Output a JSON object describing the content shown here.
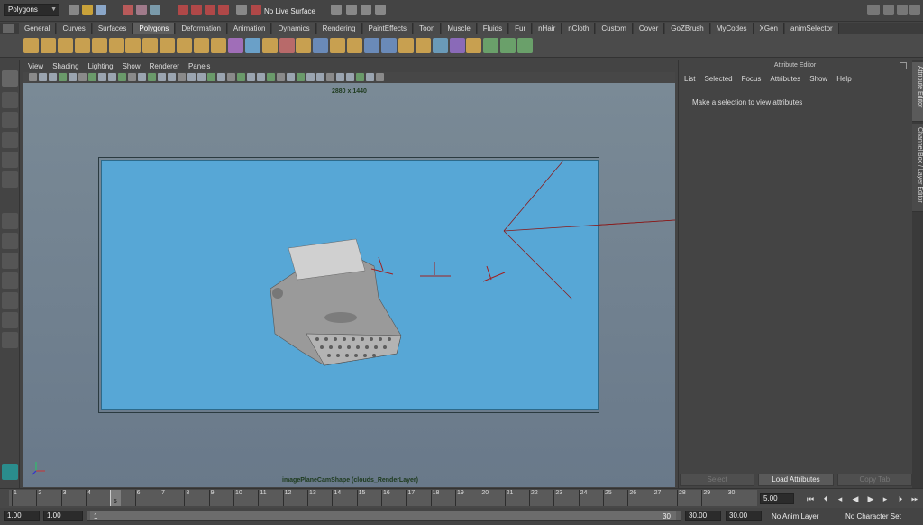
{
  "status_line": {
    "mode_menu": "Polygons",
    "live_surface": "No Live Surface"
  },
  "shelf_tabs": [
    "General",
    "Curves",
    "Surfaces",
    "Polygons",
    "Deformation",
    "Animation",
    "Dynamics",
    "Rendering",
    "PaintEffects",
    "Toon",
    "Muscle",
    "Fluids",
    "Fur",
    "nHair",
    "nCloth",
    "Custom",
    "Cover",
    "GoZBrush",
    "MyCodes",
    "XGen",
    "animSelector"
  ],
  "active_shelf_tab": "Polygons",
  "viewport": {
    "menu": [
      "View",
      "Shading",
      "Lighting",
      "Show",
      "Renderer",
      "Panels"
    ],
    "resolution_label": "2880 x 1440",
    "camera_label": "imagePlaneCamShape (clouds_RenderLayer)"
  },
  "attribute_editor": {
    "title": "Attribute Editor",
    "menu": [
      "List",
      "Selected",
      "Focus",
      "Attributes",
      "Show",
      "Help"
    ],
    "message": "Make a selection to view attributes",
    "buttons": {
      "select": "Select",
      "load": "Load Attributes",
      "copy": "Copy Tab"
    },
    "side_tabs": [
      "Attribute Editor",
      "Channel Box / Layer Editor"
    ]
  },
  "time_slider": {
    "ticks": [
      "1",
      "2",
      "3",
      "4",
      "5",
      "6",
      "7",
      "8",
      "9",
      "10",
      "11",
      "12",
      "13",
      "14",
      "15",
      "16",
      "17",
      "18",
      "19",
      "20",
      "21",
      "22",
      "23",
      "24",
      "25",
      "26",
      "27",
      "28",
      "29",
      "30"
    ],
    "current_frame": "5",
    "current_frame_field": "5.00"
  },
  "range_slider": {
    "start_field": "1.00",
    "start_inner": "1.00",
    "range_start_label": "1",
    "range_end_label": "30",
    "end_inner": "30.00",
    "end_field": "30.00",
    "anim_layer": "No Anim Layer",
    "character_set": "No Character Set"
  },
  "colors": {
    "viewport_bg": "#70808e",
    "gate_fill": "#57a7d6",
    "ui_bg": "#444444"
  }
}
